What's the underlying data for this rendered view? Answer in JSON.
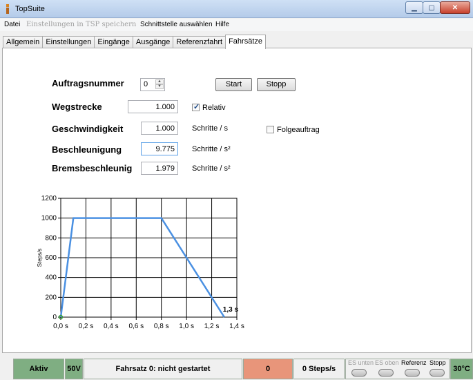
{
  "window": {
    "title": "TopSuite"
  },
  "menu": {
    "items": [
      {
        "label": "Datei",
        "disabled": false
      },
      {
        "label": "Einstellungen in TSP speichern",
        "disabled": true
      },
      {
        "label": "Schnittstelle auswählen",
        "disabled": false
      },
      {
        "label": "Hilfe",
        "disabled": false
      }
    ]
  },
  "tabs": [
    {
      "label": "Allgemein",
      "active": false
    },
    {
      "label": "Einstellungen",
      "active": false
    },
    {
      "label": "Eingänge",
      "active": false
    },
    {
      "label": "Ausgänge",
      "active": false
    },
    {
      "label": "Referenzfahrt",
      "active": false
    },
    {
      "label": "Fahrsätze",
      "active": true
    }
  ],
  "form": {
    "auftragsnummer": {
      "label": "Auftragsnummer",
      "value": "0"
    },
    "start_label": "Start",
    "stopp_label": "Stopp",
    "wegstrecke": {
      "label": "Wegstrecke",
      "value": "1.000"
    },
    "relativ": {
      "label": "Relativ",
      "checked": true
    },
    "geschwindigkeit": {
      "label": "Geschwindigkeit",
      "value": "1.000",
      "unit": "Schritte / s"
    },
    "folgeauftrag": {
      "label": "Folgeauftrag",
      "checked": false
    },
    "beschleunigung": {
      "label": "Beschleunigung",
      "value": "9.775",
      "unit": "Schritte / s²"
    },
    "bremsbeschleunigung": {
      "label": "Bremsbeschleunig",
      "value": "1.979",
      "unit": "Schritte / s²"
    }
  },
  "chart_data": {
    "type": "line",
    "ylabel": "Steps/s",
    "xlabel": "",
    "xlim": [
      0,
      1.4
    ],
    "ylim": [
      0,
      1200
    ],
    "x_ticks": [
      "0,0 s",
      "0,2 s",
      "0,4 s",
      "0,6 s",
      "0,8 s",
      "1,0 s",
      "1,2 s",
      "1,4 s"
    ],
    "y_ticks": [
      "0",
      "200",
      "400",
      "600",
      "800",
      "1000",
      "1200"
    ],
    "grid": true,
    "series": [
      {
        "color": "#4a90e2",
        "x": [
          0,
          0.1,
          0.8,
          1.3
        ],
        "y": [
          0,
          1000,
          1000,
          0
        ]
      }
    ],
    "annotations": [
      {
        "text": "1,3 s",
        "x": 1.3,
        "y": 0
      }
    ]
  },
  "status": {
    "aktiv": "Aktiv",
    "voltage": "50V",
    "fahrsatz": "Fahrsatz 0:  nicht gestartet",
    "position": "0",
    "speed": "0 Steps/s",
    "indicators": [
      {
        "label": "ES unten",
        "active": false
      },
      {
        "label": "ES oben",
        "active": false
      },
      {
        "label": "Referenz",
        "active": true
      },
      {
        "label": "Stopp",
        "active": true
      }
    ],
    "temperature": "30°C",
    "colors": {
      "green": "#7fae82",
      "salmon": "#e8957a"
    }
  }
}
